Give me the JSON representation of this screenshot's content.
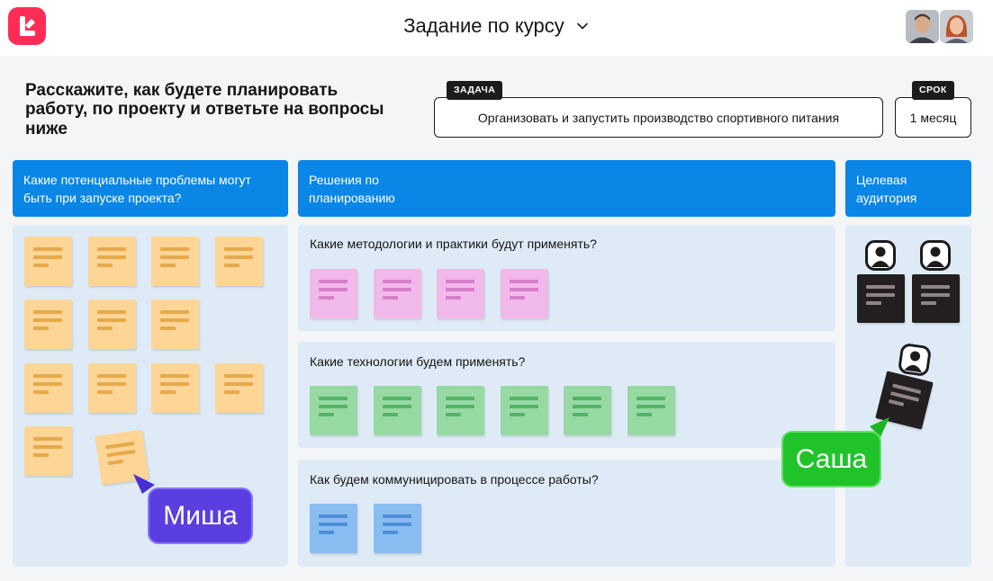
{
  "header": {
    "title": "Задание по курсу",
    "logo": {
      "name": "brand-logo",
      "color": "#ff2d55"
    },
    "avatars": [
      "avatar-male",
      "avatar-female"
    ]
  },
  "prompt": "Расскажите, как будете планировать работу, по проекту и ответьте на вопросы ниже",
  "task": {
    "tag": "ЗАДАЧА",
    "value": "Организовать и запустить производство спортивного питания"
  },
  "deadline": {
    "tag": "СРОК",
    "value": "1 месяц"
  },
  "columns": {
    "problems": {
      "header": "Какие потенциальные проблемы могут быть при запуске проекта?"
    },
    "solutions": {
      "header": "Решения по планированию",
      "sections": [
        {
          "question": "Какие методологии и практики будут применять?",
          "note_color": "pink",
          "note_count": 4
        },
        {
          "question": "Какие технологии будем применять?",
          "note_color": "green",
          "note_count": 6
        },
        {
          "question": "Как будем коммуницировать в процессе работы?",
          "note_color": "blue",
          "note_count": 2
        }
      ]
    },
    "audience": {
      "header": "Целевая аудитория"
    }
  },
  "cursors": [
    {
      "label": "Миша",
      "color": "#5a3ee0"
    },
    {
      "label": "Саша",
      "color": "#21c32a"
    }
  ],
  "colors": {
    "accent": "#0a86e6",
    "panel": "#deebf7",
    "note_yellow": "#fdd596",
    "note_pink": "#f1b8ea",
    "note_green": "#97d9a3",
    "note_blue": "#89bdf1",
    "note_dark": "#231f20"
  }
}
